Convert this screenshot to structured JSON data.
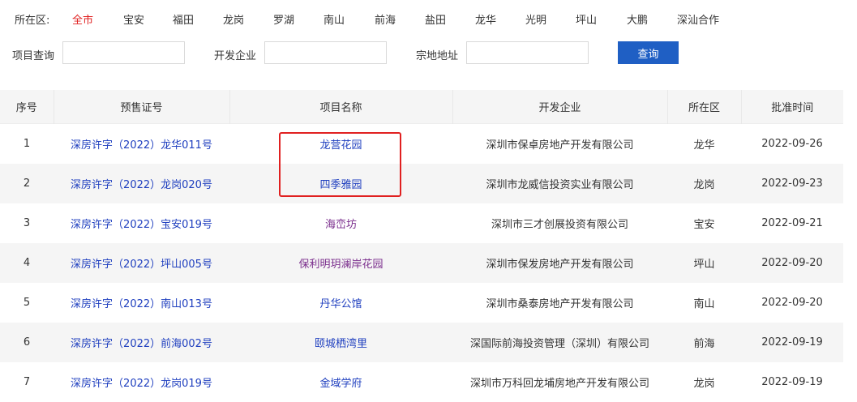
{
  "district_filter": {
    "label": "所在区:",
    "items": [
      "全市",
      "宝安",
      "福田",
      "龙岗",
      "罗湖",
      "南山",
      "前海",
      "盐田",
      "龙华",
      "光明",
      "坪山",
      "大鹏",
      "深汕合作"
    ],
    "active": "全市"
  },
  "search": {
    "project_label": "项目查询",
    "developer_label": "开发企业",
    "address_label": "宗地地址",
    "project_value": "",
    "developer_value": "",
    "address_value": "",
    "button_label": "查询"
  },
  "table": {
    "headers": [
      "序号",
      "预售证号",
      "项目名称",
      "开发企业",
      "所在区",
      "批准时间"
    ],
    "rows": [
      {
        "no": "1",
        "permit": "深房许字（2022）龙华011号",
        "project": "龙营花园",
        "developer": "深圳市保卓房地产开发有限公司",
        "district": "龙华",
        "date": "2022-09-26"
      },
      {
        "no": "2",
        "permit": "深房许字（2022）龙岗020号",
        "project": "四季雅园",
        "developer": "深圳市龙威信投资实业有限公司",
        "district": "龙岗",
        "date": "2022-09-23"
      },
      {
        "no": "3",
        "permit": "深房许字（2022）宝安019号",
        "project": "海峦坊",
        "developer": "深圳市三才创展投资有限公司",
        "district": "宝安",
        "date": "2022-09-21"
      },
      {
        "no": "4",
        "permit": "深房许字（2022）坪山005号",
        "project": "保利明玥澜岸花园",
        "developer": "深圳市保发房地产开发有限公司",
        "district": "坪山",
        "date": "2022-09-20"
      },
      {
        "no": "5",
        "permit": "深房许字（2022）南山013号",
        "project": "丹华公馆",
        "developer": "深圳市桑泰房地产开发有限公司",
        "district": "南山",
        "date": "2022-09-20"
      },
      {
        "no": "6",
        "permit": "深房许字（2022）前海002号",
        "project": "颐城栖湾里",
        "developer": "深国际前海投资管理（深圳）有限公司",
        "district": "前海",
        "date": "2022-09-19"
      },
      {
        "no": "7",
        "permit": "深房许字（2022）龙岗019号",
        "project": "金域学府",
        "developer": "深圳市万科回龙埔房地产开发有限公司",
        "district": "龙岗",
        "date": "2022-09-19"
      }
    ]
  },
  "colors": {
    "active_district": "#e02020",
    "link": "#1f3fbf",
    "visited_link": "#7a2d8c",
    "button": "#1f5fc4",
    "highlight_box": "#e02020"
  }
}
